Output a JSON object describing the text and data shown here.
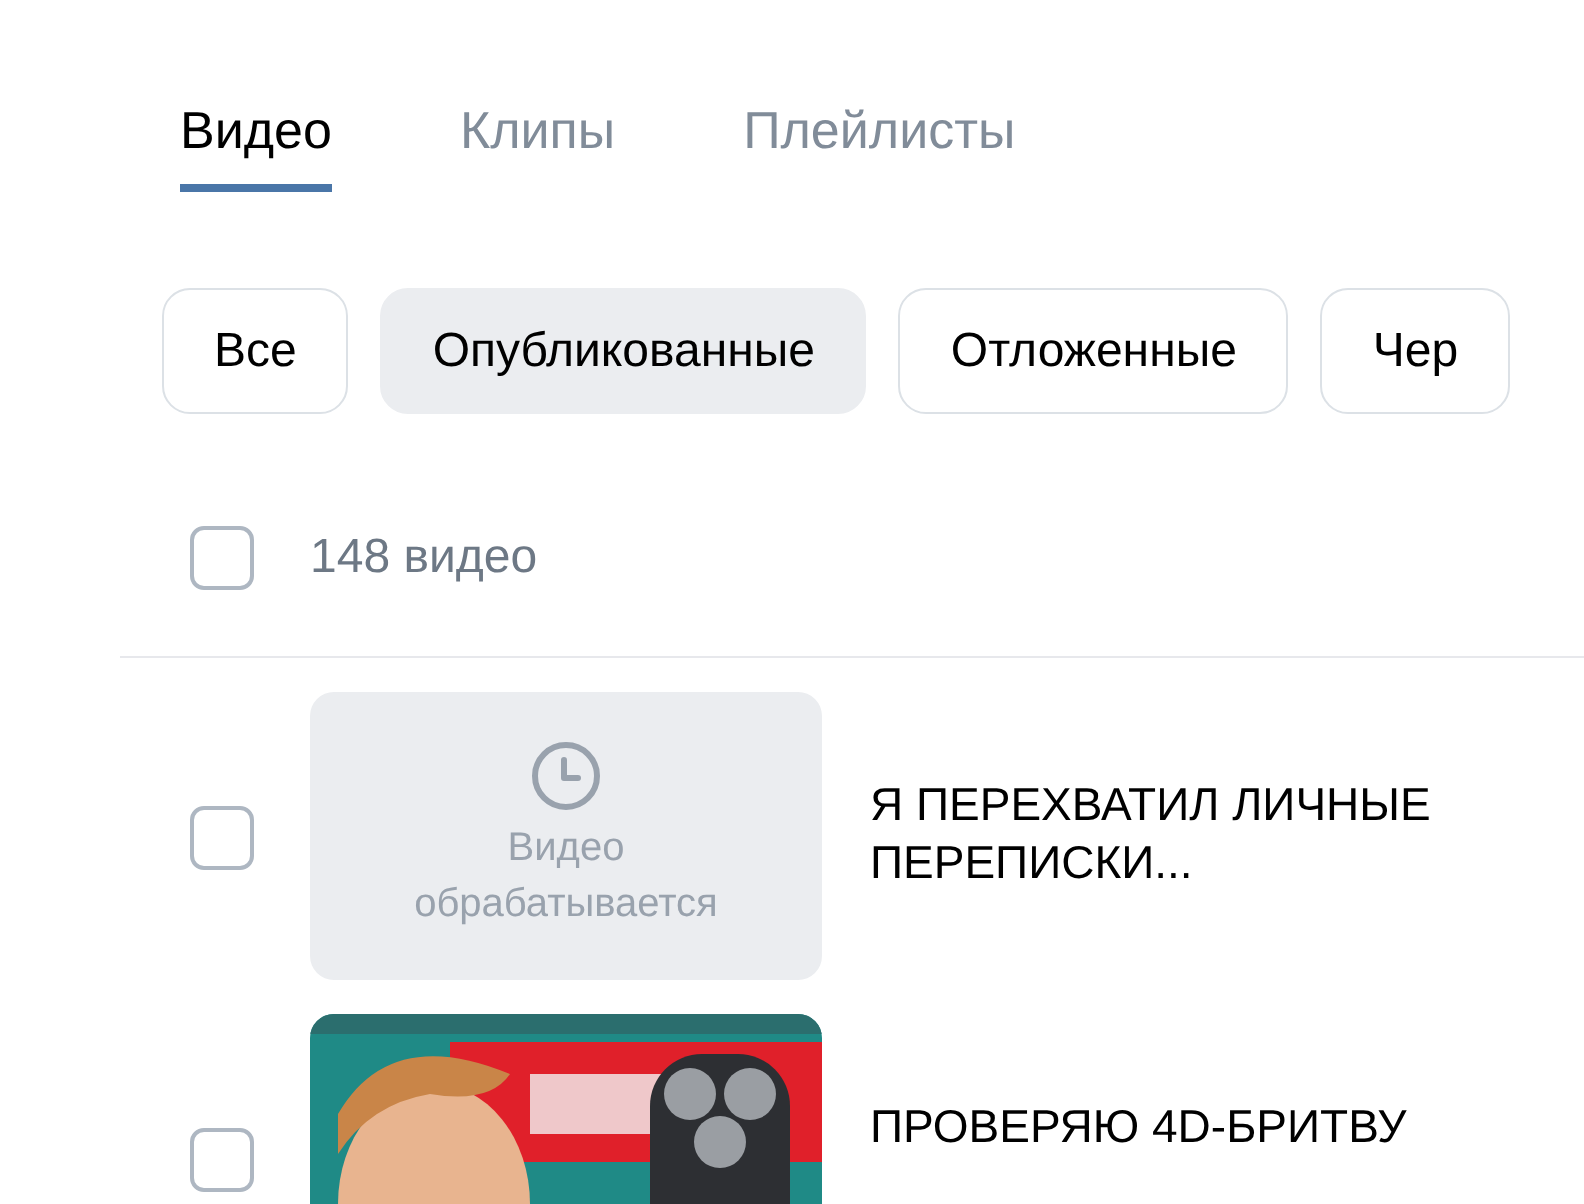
{
  "tabs": [
    {
      "label": "Видео",
      "selected": true
    },
    {
      "label": "Клипы",
      "selected": false
    },
    {
      "label": "Плейлисты",
      "selected": false
    }
  ],
  "filters": [
    {
      "label": "Все",
      "selected": false
    },
    {
      "label": "Опубликованные",
      "selected": true
    },
    {
      "label": "Отложенные",
      "selected": false
    },
    {
      "label": "Чер",
      "selected": false
    }
  ],
  "select_all": {
    "checked": false,
    "count": "148 видео"
  },
  "videos": [
    {
      "checked": false,
      "thumbnail": {
        "kind": "processing",
        "status": "Видео обрабатывается"
      },
      "title": "Я ПЕРЕХВАТИЛ ЛИЧНЫЕ ПЕРЕПИСКИ..."
    },
    {
      "checked": false,
      "title": "ПРОВЕРЯЮ 4D-БРИТВУ"
    }
  ]
}
